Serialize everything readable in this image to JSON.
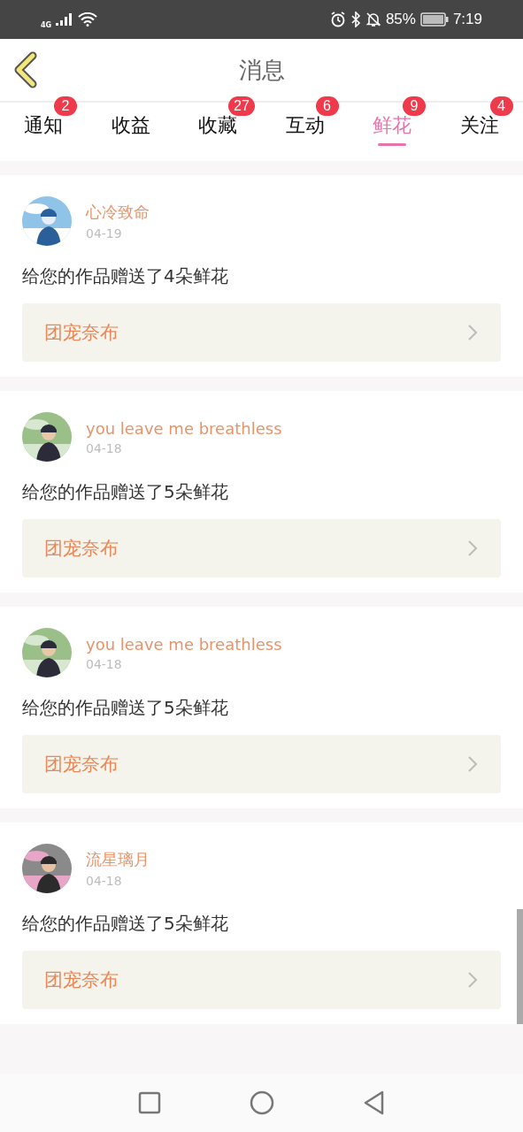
{
  "status_bar": {
    "network": "4G",
    "battery": "85%",
    "time": "7:19"
  },
  "header": {
    "title": "消息"
  },
  "tabs": [
    {
      "label": "通知",
      "badge": "2",
      "selected": false
    },
    {
      "label": "收益",
      "selected": false
    },
    {
      "label": "收藏",
      "badge": "27",
      "selected": false
    },
    {
      "label": "互动",
      "badge": "6",
      "selected": false
    },
    {
      "label": "鲜花",
      "badge": "9",
      "selected": true
    },
    {
      "label": "关注",
      "badge": "4",
      "selected": false
    }
  ],
  "messages": [
    {
      "name": "心冷致命",
      "date": "04-19",
      "text": "给您的作品赠送了4朵鲜花",
      "work": "团宠奈布"
    },
    {
      "name": "you leave me breathless",
      "date": "04-18",
      "text": "给您的作品赠送了5朵鲜花",
      "work": "团宠奈布"
    },
    {
      "name": "you leave me breathless",
      "date": "04-18",
      "text": "给您的作品赠送了5朵鲜花",
      "work": "团宠奈布"
    },
    {
      "name": "流星璃月",
      "date": "04-18",
      "text": "给您的作品赠送了5朵鲜花",
      "work": "团宠奈布"
    }
  ]
}
